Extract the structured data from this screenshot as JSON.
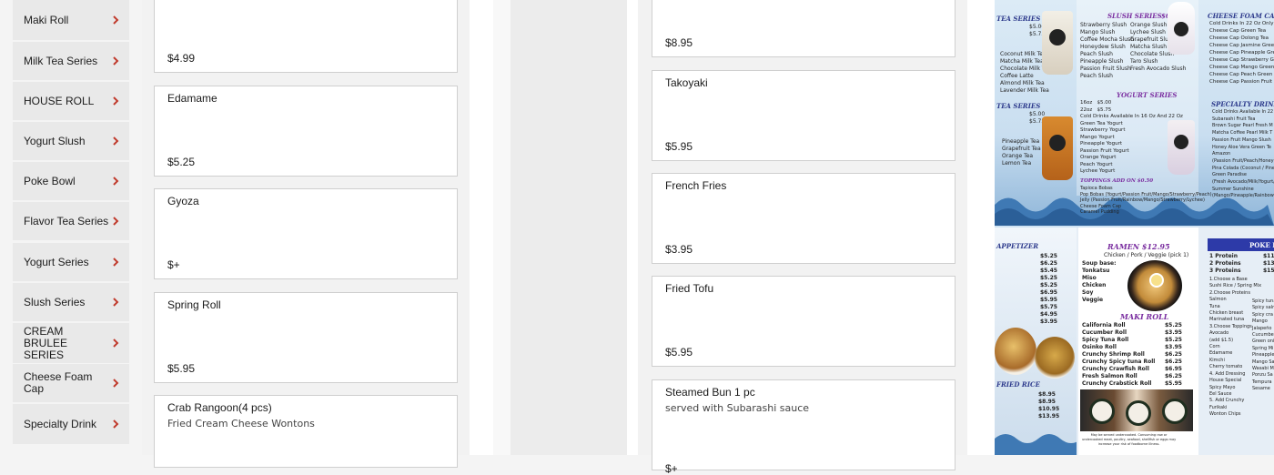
{
  "sidebar": {
    "items": [
      {
        "label": "Maki Roll"
      },
      {
        "label": "Milk Tea Series"
      },
      {
        "label": "HOUSE ROLL"
      },
      {
        "label": "Yogurt Slush"
      },
      {
        "label": "Poke Bowl"
      },
      {
        "label": "Flavor Tea Series"
      },
      {
        "label": "Yogurt Series"
      },
      {
        "label": "Slush Series"
      },
      {
        "label": "CREAM BRULEE SERIES"
      },
      {
        "label": "Cheese Foam Cap"
      },
      {
        "label": "Specialty Drink"
      }
    ]
  },
  "column_a": {
    "items": [
      {
        "name": "",
        "desc": "",
        "price": "$4.99"
      },
      {
        "name": "Edamame",
        "desc": "",
        "price": "$5.25"
      },
      {
        "name": "Gyoza",
        "desc": "",
        "price": "$+"
      },
      {
        "name": "Spring Roll",
        "desc": "",
        "price": "$5.95"
      },
      {
        "name": "Crab Rangoon(4 pcs)",
        "desc": "Fried Cream Cheese Wontons",
        "price": ""
      }
    ]
  },
  "column_b": {
    "items": [
      {
        "name": "",
        "desc": "",
        "price": "$8.95"
      },
      {
        "name": "Takoyaki",
        "desc": "",
        "price": "$5.95"
      },
      {
        "name": "French Fries",
        "desc": "",
        "price": "$3.95"
      },
      {
        "name": "Fried Tofu",
        "desc": "",
        "price": "$5.95"
      },
      {
        "name": "Steamed Bun 1 pc",
        "desc": "served with Subarashi sauce",
        "price": "$+"
      }
    ]
  },
  "menu_image": {
    "slush_title": "SLUSH SERIES",
    "slush_price": "$6.00",
    "slush_items_1": "Strawberry Slush\nMango Slush\nCoffee Mocha Slush\nHoneydew Slush\nPeach Slush\nPineapple Slush\nPassion Fruit Slush\nPeach Slush",
    "slush_items_2": "Orange Slush\nLychee Slush\nGrapefruit Slush\nMatcha Slush\nChocolate Slush\nTaro Slush\nFresh Avocado Slush",
    "yogurt_title": "YOGURT SERIES",
    "yogurt_items": "16oz   $5.00\n22oz   $5.75\nCold Drinks Available In 16 Oz And 22 Oz\nGreen Tea Yogurt\nStrawberry Yogurt\nMango Yogurt\nPineapple Yogurt\nPassion Fruit Yogurt\nOrange Yogurt\nPeach Yogurt\nLychee Yogurt",
    "toppings_title": "TOPPINGS ADD ON  $0.50",
    "toppings_items": "Tapioca Bobas\nPop Bobas (Yogurt/Passion Fruit/Mango/Strawberry/Peach)\nJelly (Passion Fruit/Rainbow/Mango/Strawberry/Lychee)\nCheese Foam Cap\nCaramel Pudding",
    "milk_tea_items": "Coconut Milk Tea\nMatcha Milk Tea\nChocolate Milk Tea\nCoffee Latte\nAlmond Milk Tea\nLavender Milk Tea",
    "milk_tea_prices": "$5.00\n$5.75",
    "fruit_tea_items": "Pineapple Tea\nGrapefruit Tea\nOrange Tea\nLemon Tea",
    "fruit_tea_prices": "$5.00\n$5.75",
    "fruit_tea_title": "TEA SERIES",
    "milk_tea_title": "TEA SERIES",
    "cheese_title": "CHEESE FOAM CAP",
    "cheese_items": "Cold Drinks In 22 Oz Only\nCheese Cap Green Tea\nCheese Cap Oolong Tea\nCheese Cap Jasmine Green\nCheese Cap Pineapple Gre\nCheese Cap Strawberry G\nCheese Cap Mango Green\nCheese Cap Peach Green T\nCheese Cap Passion Fruit G",
    "specialty_title": "SPECIALTY DRINKS",
    "specialty_items": "Cold Drinks Available In 22 Oz O\nSubarashi Fruit Tea\nBrown Sugar Pearl Fresh M\nMatcha Coffee Pearl Milk T\nPassion Fruit Mango Slush\nHoney Aloe Vera Green Te\nAmazon\n(Passion Fruit/Peach/Honeydew/Ro\nPina Colada (Coconut / Pineap\nGreen Paradise\n(Fresh Avocado/Milk/Yogurt/Pineap\nSummer Sunshine\n(Mango/Pineapple/Rainbow Jell",
    "appetizer_title": "APPETIZER",
    "appetizer_prices": "$5.25\n$6.25\n$5.45\n$5.25\n$5.25\n$6.95\n$5.95\n$5.75\n$4.95\n$3.95",
    "fried_rice_title": "FRIED RICE",
    "fried_rice_prices": "$8.95\n$8.95\n$10.95\n$13.95",
    "ramen_title": "RAMEN  $12.95",
    "ramen_sub": "Chicken / Pork / Veggie (pick 1)",
    "soup_base": "Soup base:\nTonkatsu\nMiso\nChicken\nSoy\nVeggie",
    "maki_title": "MAKI ROLL",
    "maki_items": "California Roll\nCucumber Roll\nSpicy Tuna Roll\nOsinko Roll\nCrunchy Shrimp Roll\nCrunchy Spicy tuna Roll\nCrunchy Crawfish Roll\nFresh Salmon Roll\nCrunchy Crabstick Roll",
    "maki_prices": "$5.25\n$3.95\n$5.25\n$3.95\n$6.25\n$6.25\n$6.95\n$6.25\n$5.95",
    "maki_note": "May be served undercooked. Consuming raw or\nundercooked meat, poultry, seafood, shellfish or eggs may\nincrease your risk of foodborne illness.",
    "poke_title": "POKE B",
    "poke_items": "1 Protein\n2 Proteins\n3 Proteins",
    "poke_prices": "$11\n$13\n$15",
    "poke_steps": "1.Choose a Base\nSushi Rice / Spring Mix\n2.Choose Proteins\nSalmon\nTuna\nChicken breast\nMarinated tuna\n3.Choose Toppings\nAvocado\n(add $1.5)\nCorn\nEdamame\nKimchi\nCherry tomato\n4. Add Dressing\nHouse Special\nSpicy Mayo\nEel Sauce\n5. Add Crunchy\nFurikaki\nWonton Chips",
    "poke_steps_2": "Spicy tuna\nSpicy salm\nSpicy cra\nMango\nJalapeño\nCucumber\nGreen oni\nSpring Mi\nPineapple\nMango Sa\nWasabi M\nPonzu Sa\nTempura\nSesame"
  }
}
